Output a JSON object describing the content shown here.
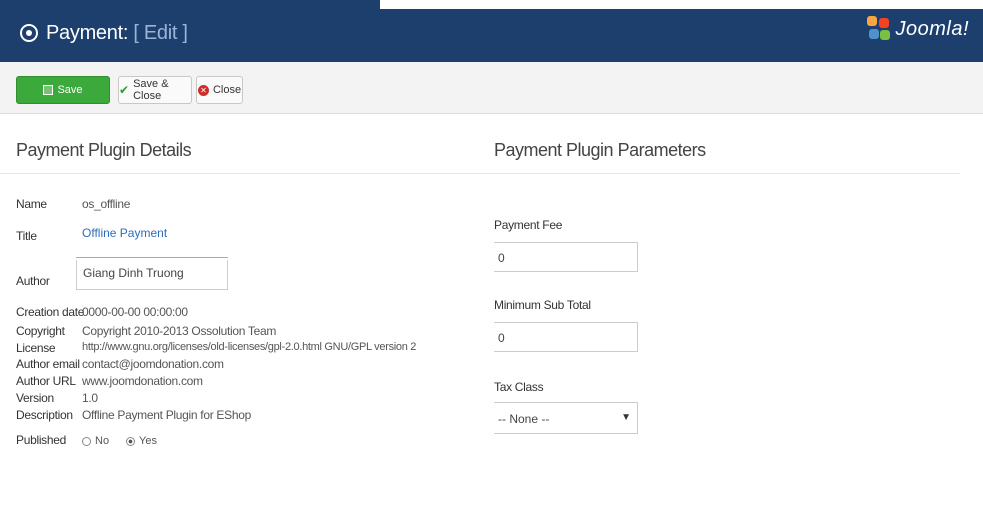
{
  "header": {
    "title": "Payment:",
    "subtitle": "[ Edit ]",
    "brand": "Joomla!"
  },
  "toolbar": {
    "save_label": "Save",
    "save_close_label": "Save & Close",
    "close_label": "Close"
  },
  "details": {
    "heading": "Payment Plugin Details",
    "name_label": "Name",
    "name_value": "os_offline",
    "title_label": "Title",
    "title_value": "Offline Payment",
    "author_label": "Author",
    "author_value": "Giang Dinh Truong",
    "creation_date_label": "Creation date",
    "creation_date_value": "0000-00-00 00:00:00",
    "copyright_label": "Copyright",
    "copyright_value": "Copyright 2010-2013 Ossolution Team",
    "license_label": "License",
    "license_value": "http://www.gnu.org/licenses/old-licenses/gpl-2.0.html GNU/GPL version 2",
    "author_email_label": "Author email",
    "author_email_value": "contact@joomdonation.com",
    "author_url_label": "Author URL",
    "author_url_value": "www.joomdonation.com",
    "version_label": "Version",
    "version_value": "1.0",
    "description_label": "Description",
    "description_value": "Offline Payment Plugin for EShop",
    "published_label": "Published",
    "published_options": [
      "No",
      "Yes"
    ],
    "published_selected": "Yes"
  },
  "parameters": {
    "heading": "Payment Plugin Parameters",
    "payment_fee_label": "Payment Fee",
    "payment_fee_value": "0",
    "min_subtotal_label": "Minimum Sub Total",
    "min_subtotal_value": "0",
    "tax_class_label": "Tax Class",
    "tax_class_selected": "-- None --"
  },
  "colors": {
    "header_bg": "#1c3f6e",
    "save_button": "#3ca93c",
    "link": "#2a6ebb"
  }
}
